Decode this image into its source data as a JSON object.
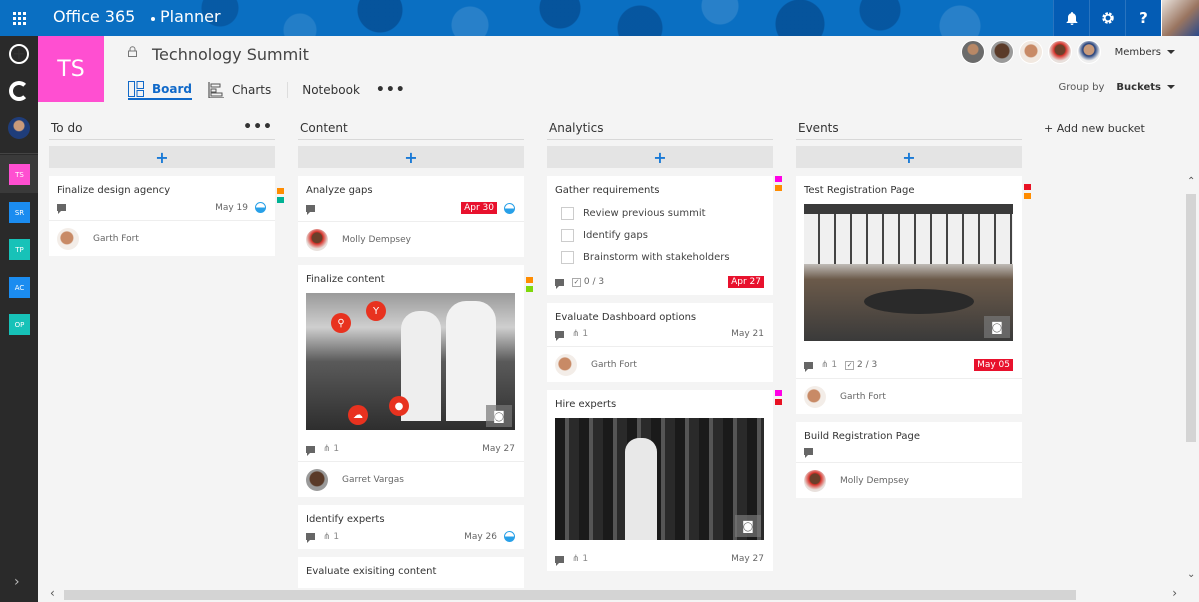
{
  "topbar": {
    "brand": "Office 365",
    "app": "Planner",
    "icons": [
      "waffle-icon",
      "bell-icon",
      "gear-icon",
      "help-icon"
    ],
    "help_glyph": "?",
    "colors": {
      "bar": "#0a6fc2"
    }
  },
  "rail": {
    "tiles": [
      {
        "label": "TS",
        "color": "#ff4fd1"
      },
      {
        "label": "SR",
        "color": "#1b8cf0"
      },
      {
        "label": "TP",
        "color": "#17c2b8"
      },
      {
        "label": "AC",
        "color": "#1b8cf0"
      },
      {
        "label": "OP",
        "color": "#17c2b8"
      }
    ],
    "expand_glyph": "›"
  },
  "plan": {
    "initials": "TS",
    "title": "Technology Summit",
    "color": "#ff4fd1",
    "tabs": [
      {
        "label": "Board",
        "active": true
      },
      {
        "label": "Charts",
        "active": false
      },
      {
        "label": "Notebook",
        "active": false
      }
    ],
    "more": "•••",
    "members_label": "Members",
    "group_by_label": "Group by",
    "group_by_value": "Buckets"
  },
  "board": {
    "add_glyph": "+",
    "add_bucket": "+ Add new bucket",
    "buckets": [
      {
        "name": "To do",
        "more": "•••",
        "cards": [
          {
            "title": "Finalize design agency",
            "due": "May 19",
            "late": false,
            "progress": "in-progress",
            "assignee": "Garth Fort",
            "labels": [
              "#ff8c00",
              "#00b294"
            ]
          }
        ]
      },
      {
        "name": "Content",
        "cards": [
          {
            "title": "Analyze gaps",
            "due": "Apr 30",
            "late": true,
            "progress": "in-progress",
            "assignee": "Molly Dempsey"
          },
          {
            "title": "Finalize content",
            "attachments": "1",
            "due": "May 27",
            "assignee": "Garret Vargas",
            "labels": [
              "#ff8c00",
              "#7fd80b"
            ]
          },
          {
            "title": "Identify experts",
            "attachments": "1",
            "due": "May 26",
            "progress": "in-progress"
          },
          {
            "title": "Evaluate exisiting content"
          }
        ]
      },
      {
        "name": "Analytics",
        "cards": [
          {
            "title": "Gather requirements",
            "checklist": [
              "Review previous summit",
              "Identify gaps",
              "Brainstorm with stakeholders"
            ],
            "checklist_count": "0 / 3",
            "due": "Apr 27",
            "late": true,
            "labels": [
              "#ff00e6",
              "#ff8c00"
            ]
          },
          {
            "title": "Evaluate Dashboard options",
            "attachments": "1",
            "due": "May 21",
            "assignee": "Garth Fort"
          },
          {
            "title": "Hire experts",
            "attachments": "1",
            "due": "May 27",
            "labels": [
              "#ff00e6",
              "#e81123"
            ]
          }
        ]
      },
      {
        "name": "Events",
        "cards": [
          {
            "title": "Test Registration Page",
            "attachments": "1",
            "checklist_count": "2 / 3",
            "due": "May 05",
            "late": true,
            "assignee": "Garth Fort",
            "labels": [
              "#e81123",
              "#ff8c00"
            ]
          },
          {
            "title": "Build Registration Page",
            "assignee": "Molly Dempsey"
          }
        ]
      }
    ]
  },
  "scroll": {
    "up": "^",
    "down": "v",
    "left": "<",
    "right": ">"
  }
}
